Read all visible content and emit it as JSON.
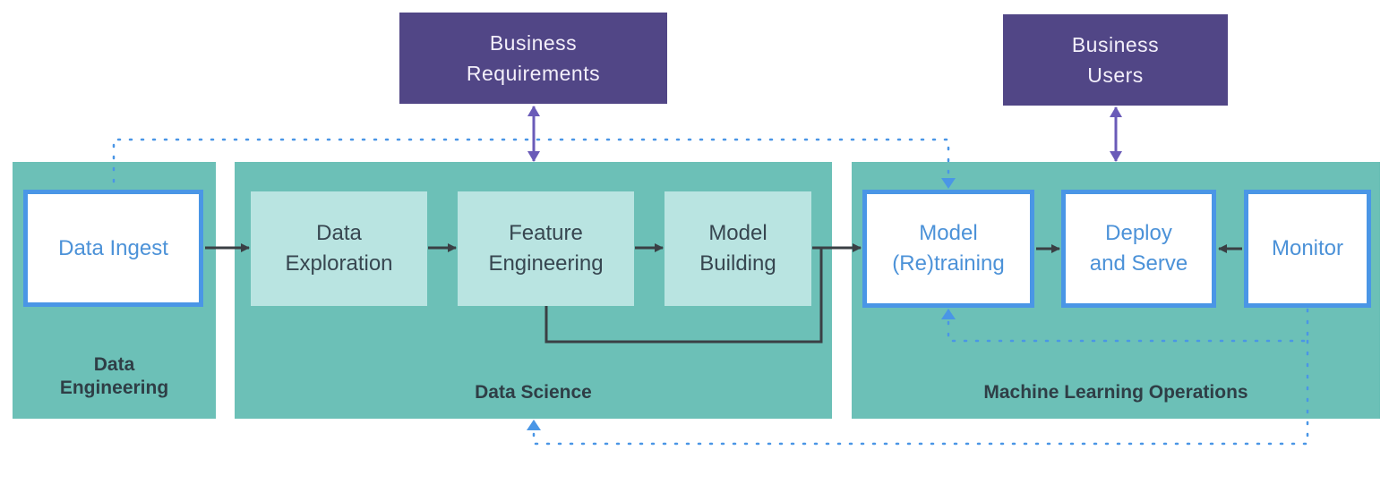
{
  "stakeholders": [
    {
      "id": "business-requirements",
      "label": "Business\nRequirements"
    },
    {
      "id": "business-users",
      "label": "Business\nUsers"
    }
  ],
  "groups": [
    {
      "id": "data-engineering",
      "label": "Data\nEngineering"
    },
    {
      "id": "data-science",
      "label": "Data Science"
    },
    {
      "id": "mlops",
      "label": "Machine Learning Operations"
    }
  ],
  "steps": {
    "data_ingest": "Data Ingest",
    "data_exploration": "Data\nExploration",
    "feature_engineering": "Feature\nEngineering",
    "model_building": "Model\nBuilding",
    "model_retraining": "Model\n(Re)training",
    "deploy_serve": "Deploy\nand Serve",
    "monitor": "Monitor"
  },
  "colors": {
    "group_fill": "#6cc0b7",
    "ds_step_fill": "#b9e4e1",
    "stakeholder_fill": "#514686",
    "stakeholder_arrow": "#6a5bb8",
    "step_border": "#4a96e6",
    "step_text": "#4c92d8",
    "flow_arrow": "#3a3f44",
    "feedback_dotted": "#4a96e6"
  },
  "connections": [
    {
      "from": "Data Ingest",
      "to": "Data Exploration",
      "style": "solid"
    },
    {
      "from": "Data Exploration",
      "to": "Feature Engineering",
      "style": "solid"
    },
    {
      "from": "Feature Engineering",
      "to": "Model Building",
      "style": "solid"
    },
    {
      "from": "Model Building",
      "to": "Model (Re)training",
      "style": "solid"
    },
    {
      "from": "Feature Engineering",
      "to": "Model (Re)training",
      "style": "solid-elbow"
    },
    {
      "from": "Model (Re)training",
      "to": "Deploy and Serve",
      "style": "solid"
    },
    {
      "from": "Monitor",
      "to": "Deploy and Serve",
      "style": "solid"
    },
    {
      "from": "Data Ingest",
      "to": "Model (Re)training",
      "style": "dotted"
    },
    {
      "from": "Monitor",
      "to": "Model (Re)training",
      "style": "dotted"
    },
    {
      "from": "Monitor",
      "to": "Data Science",
      "style": "dotted"
    },
    {
      "from": "Business Requirements",
      "to": "Data Science",
      "style": "bidirectional"
    },
    {
      "from": "Business Users",
      "to": "Machine Learning Operations",
      "style": "bidirectional"
    }
  ]
}
